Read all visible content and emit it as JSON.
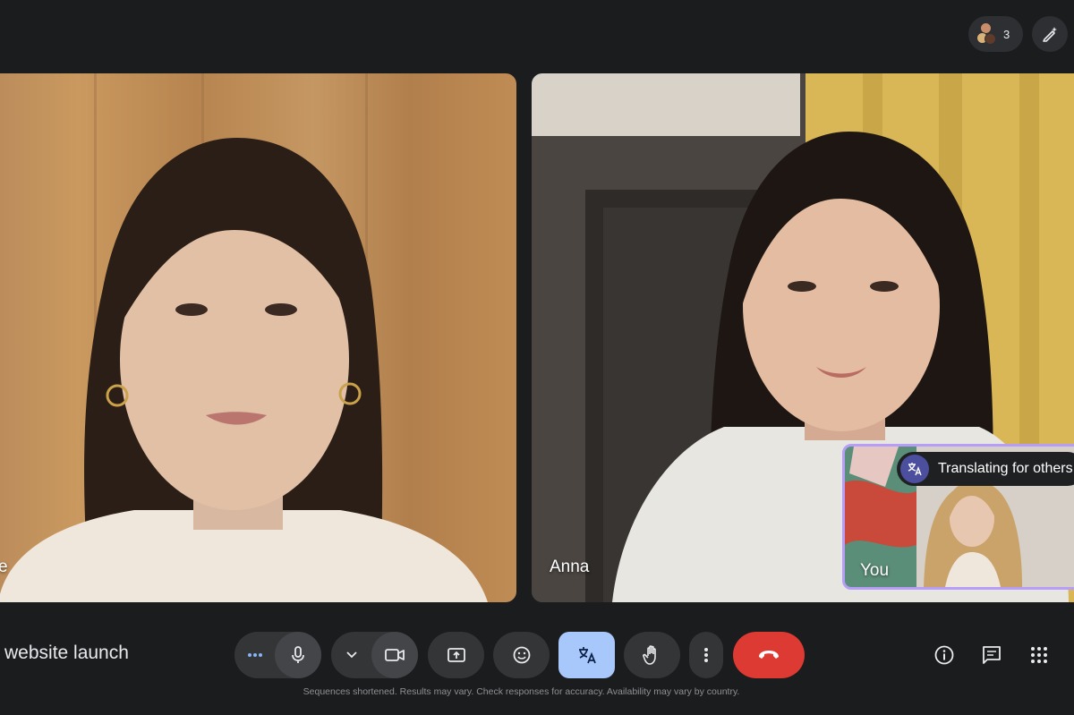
{
  "header": {
    "participant_count": "3"
  },
  "tiles": [
    {
      "name": "e"
    },
    {
      "name": "Anna"
    }
  ],
  "self_view": {
    "label": "You",
    "translate_chip": "Translating for others",
    "accent_color": "#b69df8"
  },
  "meeting": {
    "title": "website launch"
  },
  "controls": [
    {
      "icon": "more-dots-icon"
    },
    {
      "icon": "microphone-icon"
    },
    {
      "icon": "chevron-down-icon"
    },
    {
      "icon": "camera-icon"
    },
    {
      "icon": "present-screen-icon"
    },
    {
      "icon": "emoji-icon"
    },
    {
      "icon": "translate-icon",
      "active": true
    },
    {
      "icon": "raise-hand-icon"
    },
    {
      "icon": "more-vert-icon"
    },
    {
      "icon": "end-call-icon",
      "color": "#dc3a32"
    }
  ],
  "side_controls": [
    {
      "icon": "info-icon"
    },
    {
      "icon": "chat-icon"
    },
    {
      "icon": "apps-grid-icon"
    }
  ],
  "footer": {
    "disclaimer": "Sequences shortened. Results may vary. Check responses for accuracy. Availability may vary by country."
  }
}
